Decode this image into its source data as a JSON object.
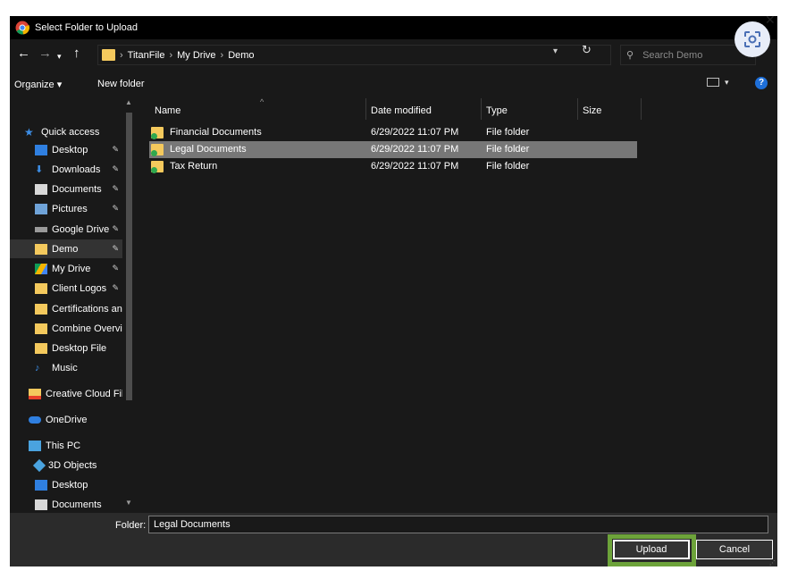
{
  "window": {
    "title": "Select Folder to Upload"
  },
  "address": {
    "crumbs": [
      "TitanFile",
      "My Drive",
      "Demo"
    ],
    "search_placeholder": "Search Demo"
  },
  "toolbar": {
    "organize": "Organize ▾",
    "new_folder": "New folder"
  },
  "sidebar": {
    "items": [
      {
        "label": "Quick access",
        "icon": "star-icon",
        "pinned": false
      },
      {
        "label": "Desktop",
        "icon": "desktop-icon",
        "pinned": true
      },
      {
        "label": "Downloads",
        "icon": "download-icon",
        "pinned": true
      },
      {
        "label": "Documents",
        "icon": "documents-icon",
        "pinned": true
      },
      {
        "label": "Pictures",
        "icon": "pictures-icon",
        "pinned": true
      },
      {
        "label": "Google Drive",
        "icon": "drive-icon",
        "pinned": true
      },
      {
        "label": "Demo",
        "icon": "folder-icon",
        "pinned": true
      },
      {
        "label": "My Drive",
        "icon": "google-drive-icon",
        "pinned": true
      },
      {
        "label": "Client Logos",
        "icon": "folder-icon",
        "pinned": true
      },
      {
        "label": "Certifications an",
        "icon": "folder-icon",
        "pinned": false
      },
      {
        "label": "Combine Overvi",
        "icon": "folder-icon",
        "pinned": false
      },
      {
        "label": "Desktop File",
        "icon": "folder-icon",
        "pinned": false
      },
      {
        "label": "Music",
        "icon": "music-icon",
        "pinned": false
      },
      {
        "label": "Creative Cloud Fil",
        "icon": "creative-cloud-icon",
        "pinned": false
      },
      {
        "label": "OneDrive",
        "icon": "onedrive-icon",
        "pinned": false
      },
      {
        "label": "This PC",
        "icon": "pc-icon",
        "pinned": false
      },
      {
        "label": "3D Objects",
        "icon": "3d-objects-icon",
        "pinned": false
      },
      {
        "label": "Desktop",
        "icon": "desktop-icon",
        "pinned": false
      },
      {
        "label": "Documents",
        "icon": "documents-icon",
        "pinned": false
      }
    ]
  },
  "columns": {
    "name": "Name",
    "date": "Date modified",
    "type": "Type",
    "size": "Size"
  },
  "files": [
    {
      "name": "Financial Documents",
      "date": "6/29/2022 11:07 PM",
      "type": "File folder"
    },
    {
      "name": "Legal Documents",
      "date": "6/29/2022 11:07 PM",
      "type": "File folder"
    },
    {
      "name": "Tax Return",
      "date": "6/29/2022 11:07 PM",
      "type": "File folder"
    }
  ],
  "footer": {
    "folder_label": "Folder:",
    "folder_value": "Legal Documents",
    "upload": "Upload",
    "cancel": "Cancel"
  },
  "colors": {
    "accent": "#6da33a",
    "folder": "#f4c95d",
    "selected": "#777777"
  }
}
